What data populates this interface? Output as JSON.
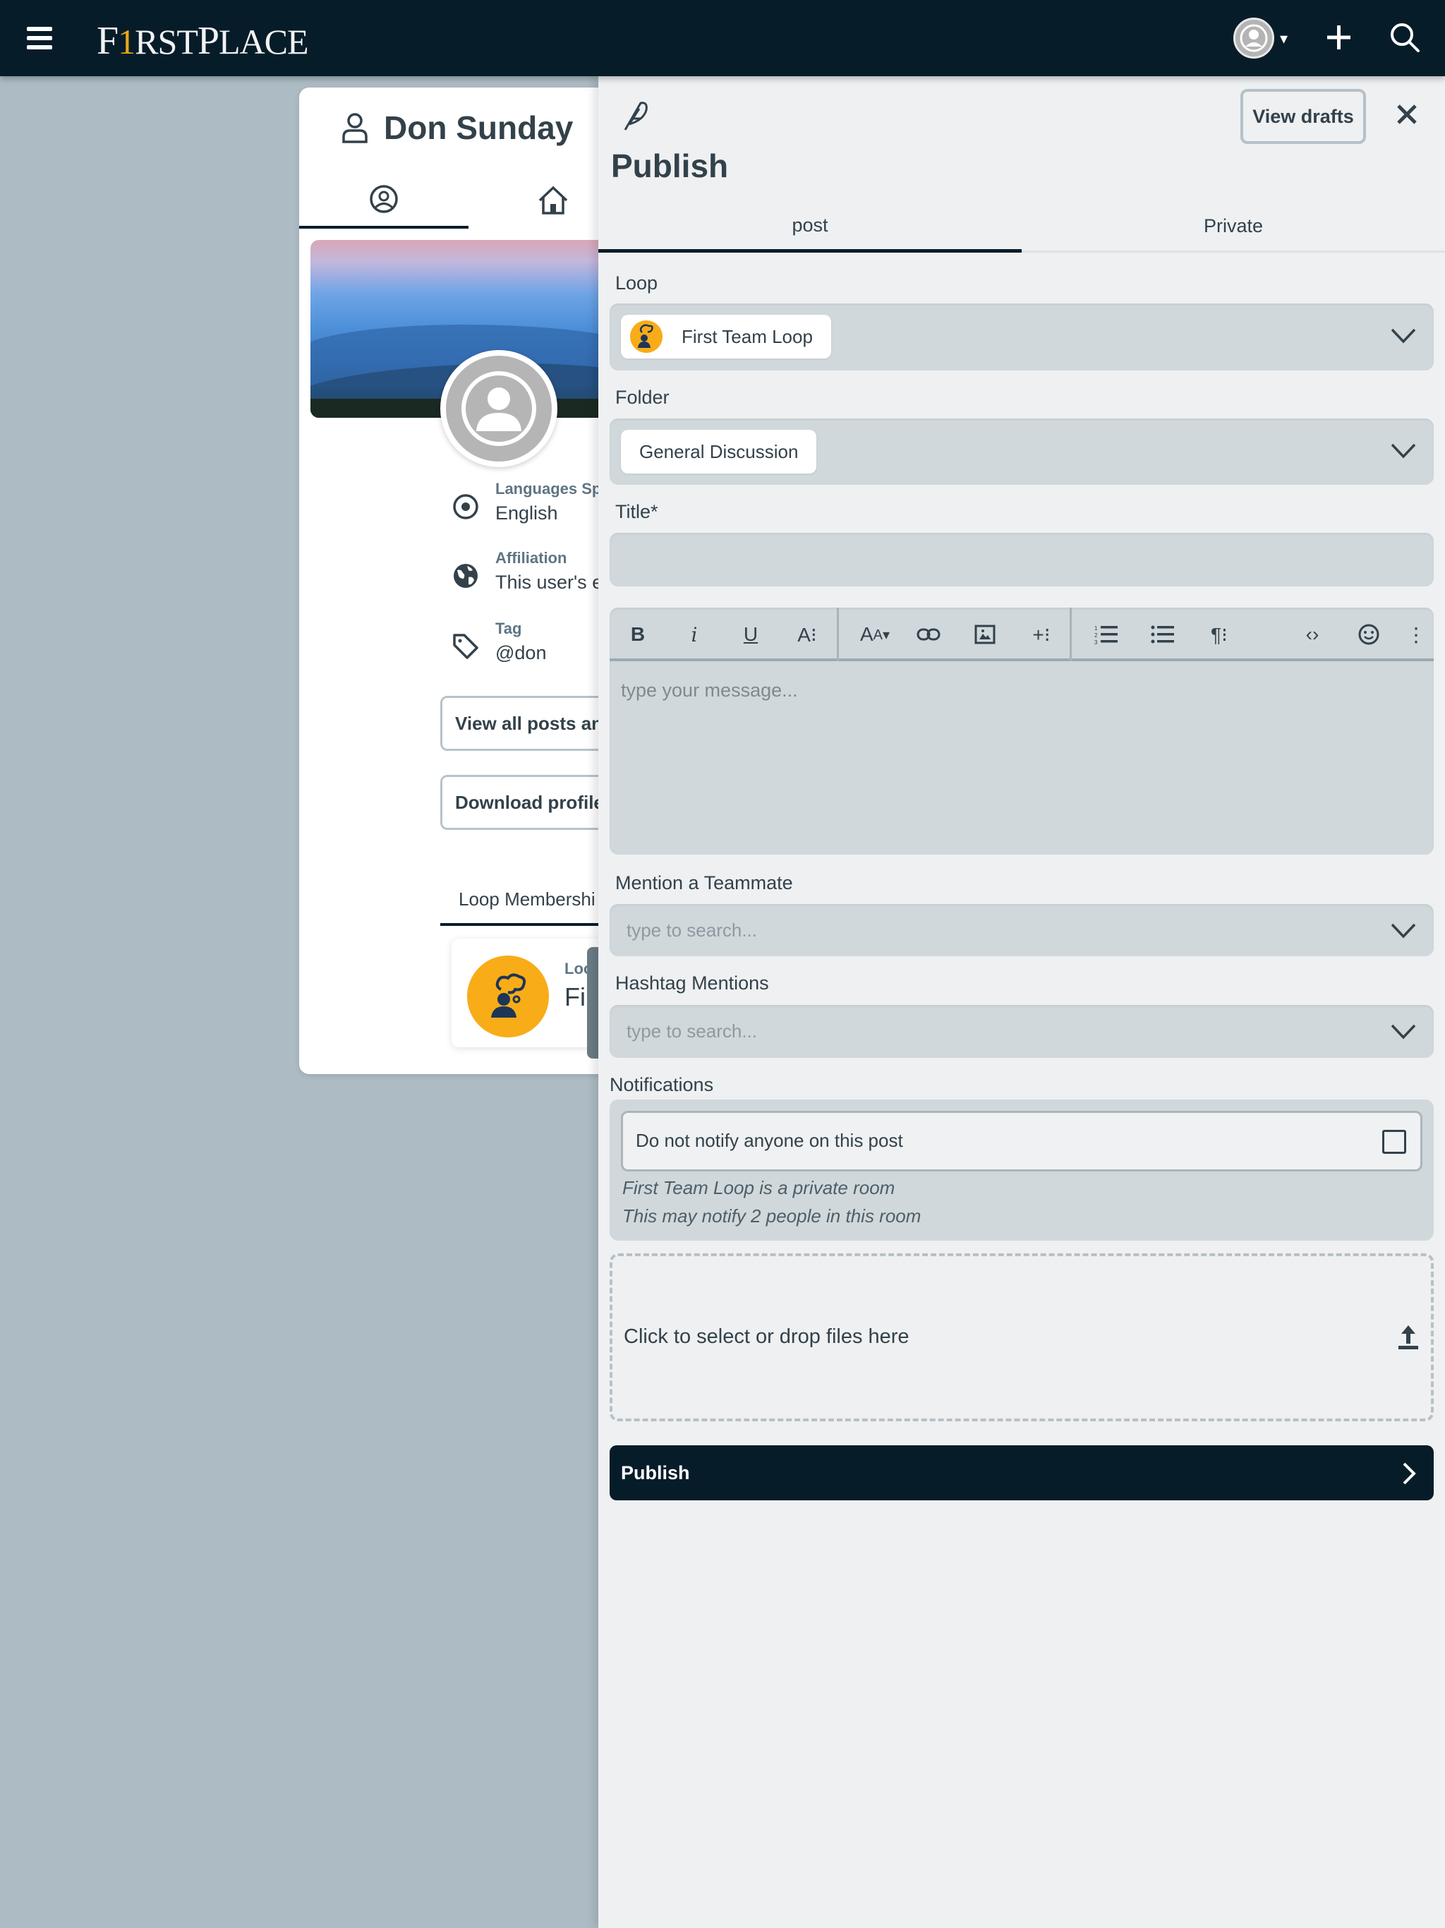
{
  "topbar": {
    "logo_first": "F",
    "logo_one": "1",
    "logo_rst": "RST",
    "logo_p": "P",
    "logo_lace": "LACE",
    "caret": "▾",
    "icons": [
      "menu-icon",
      "avatar",
      "plus-icon",
      "search-icon"
    ]
  },
  "profile": {
    "name": "Don Sunday",
    "tabs": [
      "profile-tab",
      "home-tab"
    ],
    "fields": [
      {
        "label": "Languages Sp",
        "value": "English",
        "icon": "radio-icon"
      },
      {
        "label": "Affiliation",
        "value": "This user's e",
        "icon": "globe-icon"
      },
      {
        "label": "Tag",
        "value": "@don",
        "icon": "tag-icon"
      }
    ],
    "buttons": [
      "View all posts an",
      "Download profile"
    ],
    "loop_tab": "Loop Membershi",
    "loop_card": {
      "label": "Loop",
      "value": "First Team Loop"
    }
  },
  "panel": {
    "view_drafts": "View drafts",
    "title": "Publish",
    "tabs": [
      "post",
      "Private"
    ],
    "active_tab": "post",
    "loop": {
      "label": "Loop",
      "value": "First Team Loop"
    },
    "folder": {
      "label": "Folder",
      "value": "General Discussion"
    },
    "title_field": {
      "label": "Title*",
      "value": ""
    },
    "editor": {
      "placeholder": "type your message...",
      "toolbar": [
        "bold",
        "italic",
        "underline",
        "text-style",
        "font-size",
        "link",
        "image",
        "insert-more",
        "ordered-list",
        "unordered-list",
        "paragraph",
        "code",
        "emoji",
        "more"
      ]
    },
    "mention": {
      "label": "Mention a Teammate",
      "placeholder": "type to search..."
    },
    "hashtag": {
      "label": "Hashtag Mentions",
      "placeholder": "type to search..."
    },
    "notifications": {
      "label": "Notifications",
      "checkbox_label": "Do not notify anyone on this post",
      "checked": false,
      "note1": "First Team Loop is a private room",
      "note2": "This may notify 2 people in this room"
    },
    "dropzone": "Click to select or drop files here",
    "publish_button": "Publish"
  }
}
